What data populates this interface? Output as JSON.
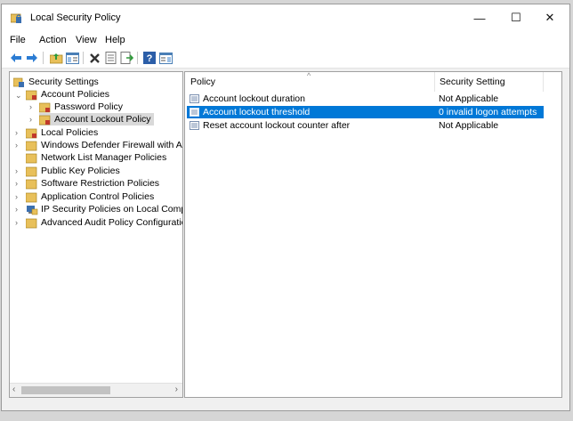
{
  "window": {
    "title": "Local Security Policy",
    "controls": {
      "minimize": "—",
      "maximize": "☐",
      "close": "✕"
    }
  },
  "menu": [
    "File",
    "Action",
    "View",
    "Help"
  ],
  "toolbar": {
    "buttons": [
      "back-icon",
      "forward-icon",
      "up-folder-icon",
      "show-hide-tree-icon",
      "delete-icon",
      "properties-icon",
      "export-list-icon",
      "help-icon",
      "console-tree-icon"
    ]
  },
  "tree": {
    "root": "Security Settings",
    "items": [
      {
        "label": "Account Policies",
        "level": 1,
        "expanded": true
      },
      {
        "label": "Password Policy",
        "level": 2
      },
      {
        "label": "Account Lockout Policy",
        "level": 2,
        "selected": true
      },
      {
        "label": "Local Policies",
        "level": 1
      },
      {
        "label": "Windows Defender Firewall with Adva",
        "level": 1
      },
      {
        "label": "Network List Manager Policies",
        "level": 1
      },
      {
        "label": "Public Key Policies",
        "level": 1
      },
      {
        "label": "Software Restriction Policies",
        "level": 1
      },
      {
        "label": "Application Control Policies",
        "level": 1
      },
      {
        "label": "IP Security Policies on Local Compute",
        "level": 1
      },
      {
        "label": "Advanced Audit Policy Configuration",
        "level": 1
      }
    ]
  },
  "list": {
    "columns": [
      "Policy",
      "Security Setting"
    ],
    "rows": [
      {
        "policy": "Account lockout duration",
        "setting": "Not Applicable",
        "selected": false
      },
      {
        "policy": "Account lockout threshold",
        "setting": "0 invalid logon attempts",
        "selected": true
      },
      {
        "policy": "Reset account lockout counter after",
        "setting": "Not Applicable",
        "selected": false
      }
    ]
  },
  "colors": {
    "selection": "#0078d7",
    "folder": "#e8c05a",
    "inactive_selection": "#d9d9d9"
  }
}
